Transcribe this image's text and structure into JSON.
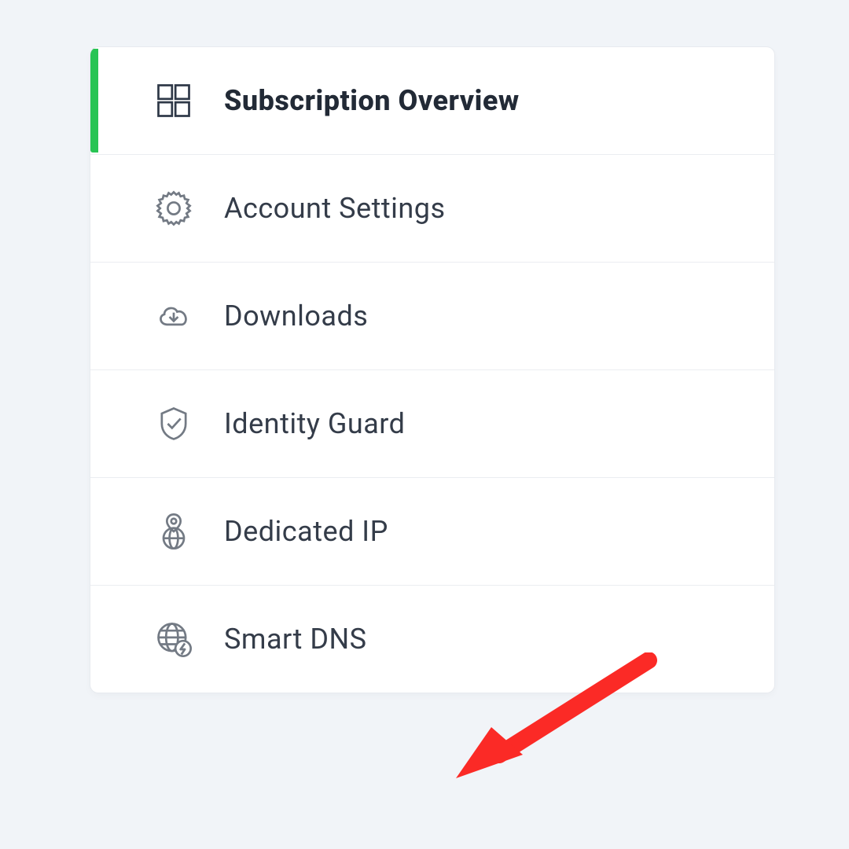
{
  "sidebar": {
    "items": [
      {
        "label": "Subscription Overview"
      },
      {
        "label": "Account Settings"
      },
      {
        "label": "Downloads"
      },
      {
        "label": "Identity Guard"
      },
      {
        "label": "Dedicated IP"
      },
      {
        "label": "Smart DNS"
      }
    ]
  },
  "colors": {
    "accent": "#28c454",
    "annotation": "#fb2a26"
  }
}
